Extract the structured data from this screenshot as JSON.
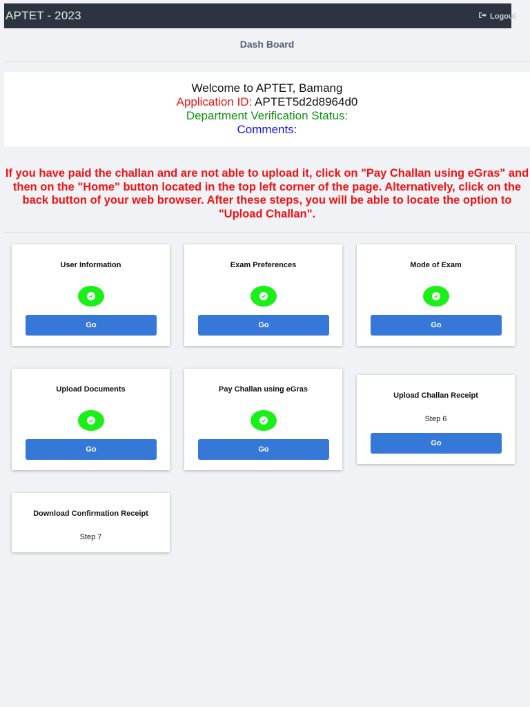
{
  "header": {
    "app_title": "APTET - 2023",
    "logout_label": "Logout",
    "logout_icon": "sign-out-icon"
  },
  "page_title": "Dash Board",
  "welcome": {
    "greeting": "Welcome to APTET, Bamang",
    "application_id_label": "Application ID:",
    "application_id_value": "APTET5d2d8964d0",
    "department_status_label": "Department Verification Status:",
    "comments_label": "Comments:"
  },
  "notice": "If you have paid the challan and are not able to upload it, click on \"Pay Challan using eGras\" and then on the \"Home\" button located in the top left corner of the page. Alternatively, click on the back button of your web browser. After these steps, you will be able to locate the option to \"Upload Challan\".",
  "colors": {
    "check_green": "#18f018",
    "button_blue": "#3578d8",
    "notice_red": "#ef1313"
  },
  "cards": [
    {
      "title": "User Information",
      "status": "completed",
      "button_label": "Go"
    },
    {
      "title": "Exam Preferences",
      "status": "completed",
      "button_label": "Go"
    },
    {
      "title": "Mode of Exam",
      "status": "completed",
      "button_label": "Go"
    },
    {
      "title": "Upload Documents",
      "status": "completed",
      "button_label": "Go"
    },
    {
      "title": "Pay Challan using eGras",
      "status": "completed",
      "button_label": "Go"
    },
    {
      "title": "Upload Challan Receipt",
      "step_label": "Step 6",
      "button_label": "Go"
    },
    {
      "title": "Download Confirmation Receipt",
      "step_label": "Step 7"
    }
  ]
}
